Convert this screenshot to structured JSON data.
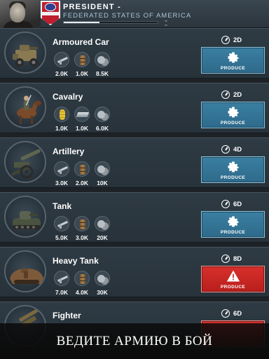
{
  "header": {
    "title": "PRESIDENT -",
    "subtitle": "FEDERATED STATES OF AMERICA",
    "progress": 0.38
  },
  "units": [
    {
      "name": "Armoured Car",
      "time": "2D",
      "button": "PRODUCE",
      "button_state": "available",
      "resources": [
        {
          "icon": "weapon-icon",
          "value": "2.0K"
        },
        {
          "icon": "barrel-icon",
          "value": "1.0K"
        },
        {
          "icon": "coins-icon",
          "value": "8.5K"
        }
      ]
    },
    {
      "name": "Cavalry",
      "time": "2D",
      "button": "PRODUCE",
      "button_state": "available",
      "resources": [
        {
          "icon": "food-icon",
          "value": "1.0K"
        },
        {
          "icon": "steel-icon",
          "value": "1.0K"
        },
        {
          "icon": "coins-icon",
          "value": "6.0K"
        }
      ]
    },
    {
      "name": "Artillery",
      "time": "4D",
      "button": "PRODUCE",
      "button_state": "available",
      "resources": [
        {
          "icon": "weapon-icon",
          "value": "3.0K"
        },
        {
          "icon": "barrel-icon",
          "value": "2.0K"
        },
        {
          "icon": "coins-icon",
          "value": "10K"
        }
      ]
    },
    {
      "name": "Tank",
      "time": "6D",
      "button": "PRODUCE",
      "button_state": "available",
      "resources": [
        {
          "icon": "weapon-icon",
          "value": "5.0K"
        },
        {
          "icon": "barrel-icon",
          "value": "3.0K"
        },
        {
          "icon": "coins-icon",
          "value": "20K"
        }
      ]
    },
    {
      "name": "Heavy Tank",
      "time": "8D",
      "button": "PRODUCE",
      "button_state": "insufficient",
      "resources": [
        {
          "icon": "weapon-icon",
          "value": "7.0K"
        },
        {
          "icon": "barrel-icon",
          "value": "4.0K"
        },
        {
          "icon": "coins-icon",
          "value": "30K"
        }
      ]
    },
    {
      "name": "Fighter",
      "time": "6D",
      "button": "",
      "button_state": "insufficient",
      "resources": []
    }
  ],
  "banner": "ВЕДИТЕ АРМИЮ В БОЙ",
  "colors": {
    "produce": "#2e6a8a",
    "produce_disabled": "#c42622",
    "background": "#1d2227"
  }
}
